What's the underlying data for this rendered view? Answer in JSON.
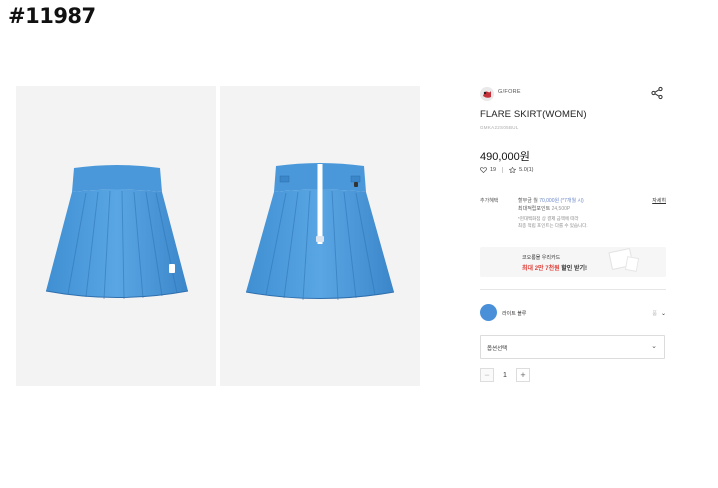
{
  "tag": "#11987",
  "brand": {
    "name": "G/FORE",
    "logo_icon": "brand-logo-icon"
  },
  "product": {
    "title": "FLARE SKIRT(WOMEN)",
    "code": "GMKA22S05BUL",
    "price": "490,000원",
    "likes": "19",
    "rating": "5.0(1)",
    "color_hex": "#4a90d9"
  },
  "benefits": {
    "label": "추가혜택",
    "line1_a": "할부금 월",
    "line1_b": "70,000원 (*7개월 시)",
    "line2_a": "최대적립포인트",
    "line2_b": "24,500P",
    "line3": "*현대백화점 상 결제 금액에 따라",
    "line4": "최종 적립 포인트는 다를 수 있습니다.",
    "detail": "자세히"
  },
  "banner": {
    "line1": "코오롱몰 우리카드",
    "line2_a": "최대 2만 7천원",
    "line2_b": "할인 받기!"
  },
  "color_option": {
    "name": "라이트 블루",
    "extra": "품"
  },
  "option_select": {
    "label": "옵션선택"
  },
  "quantity": {
    "minus": "−",
    "value": "1",
    "plus": "+"
  }
}
